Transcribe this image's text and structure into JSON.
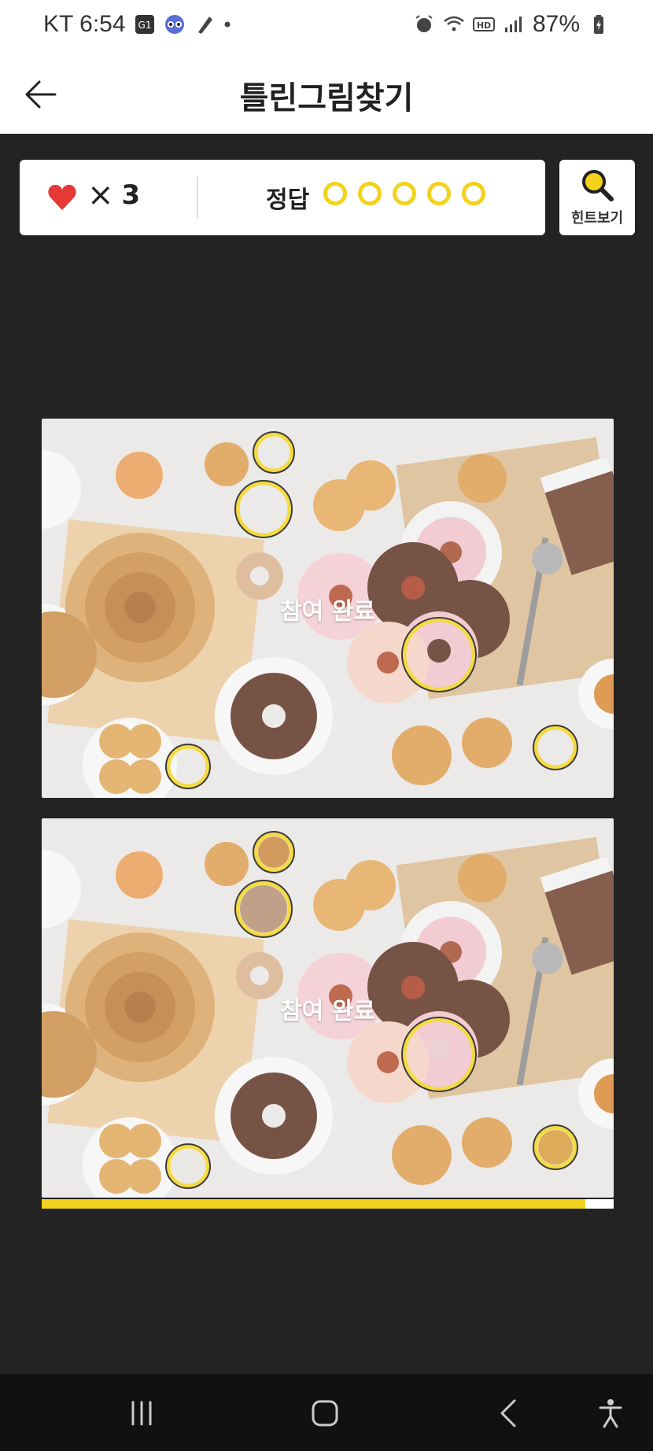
{
  "status_bar": {
    "carrier_time": "KT 6:54",
    "battery": "87%",
    "icons": [
      "g1-app-icon",
      "owl-app-icon",
      "feather-app-icon",
      "dot-icon",
      "alarm-icon",
      "wifi-icon",
      "hd-icon",
      "signal-icon",
      "battery-icon"
    ]
  },
  "appbar": {
    "title": "틀린그림찾기"
  },
  "score": {
    "lives_symbol": "×",
    "lives": "3",
    "answer_label": "정답",
    "answers_total": 5
  },
  "hint": {
    "label": "힌트보기"
  },
  "game": {
    "top_overlay": "참여 완료",
    "bottom_overlay": "참여 완료",
    "timer_progress": 0.95
  },
  "colors": {
    "accent": "#f2d21a",
    "heart": "#e53935",
    "background": "#232323"
  }
}
